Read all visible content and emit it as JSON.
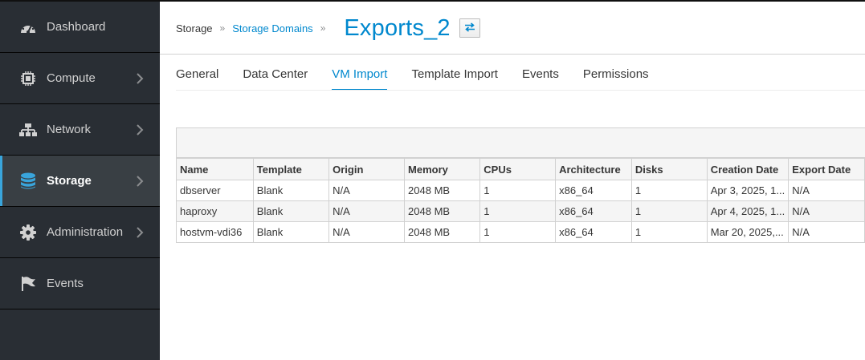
{
  "sidebar": {
    "items": [
      {
        "label": "Dashboard",
        "icon": "dashboard-icon",
        "has_chevron": false
      },
      {
        "label": "Compute",
        "icon": "cpu-icon",
        "has_chevron": true
      },
      {
        "label": "Network",
        "icon": "network-icon",
        "has_chevron": true
      },
      {
        "label": "Storage",
        "icon": "database-icon",
        "has_chevron": true,
        "active": true
      },
      {
        "label": "Administration",
        "icon": "gear-icon",
        "has_chevron": true
      },
      {
        "label": "Events",
        "icon": "flag-icon",
        "has_chevron": false
      }
    ]
  },
  "breadcrumb": {
    "root": "Storage",
    "separator": "»",
    "link": "Storage Domains",
    "title": "Exports_2"
  },
  "tabs": [
    {
      "label": "General"
    },
    {
      "label": "Data Center"
    },
    {
      "label": "VM Import",
      "active": true
    },
    {
      "label": "Template Import"
    },
    {
      "label": "Events"
    },
    {
      "label": "Permissions"
    }
  ],
  "table": {
    "columns": [
      "Name",
      "Template",
      "Origin",
      "Memory",
      "CPUs",
      "Architecture",
      "Disks",
      "Creation Date",
      "Export Date"
    ],
    "rows": [
      [
        "dbserver",
        "Blank",
        "N/A",
        "2048 MB",
        "1",
        "x86_64",
        "1",
        "Apr 3, 2025, 1...",
        "N/A"
      ],
      [
        "haproxy",
        "Blank",
        "N/A",
        "2048 MB",
        "1",
        "x86_64",
        "1",
        "Apr 4, 2025, 1...",
        "N/A"
      ],
      [
        "hostvm-vdi36",
        "Blank",
        "N/A",
        "2048 MB",
        "1",
        "x86_64",
        "1",
        "Mar 20, 2025,...",
        "N/A"
      ]
    ]
  },
  "colors": {
    "accent": "#0088ce",
    "sidebar_bg": "#292e34",
    "sidebar_active_bg": "#393f44",
    "sidebar_active_bar": "#39a5dc"
  }
}
